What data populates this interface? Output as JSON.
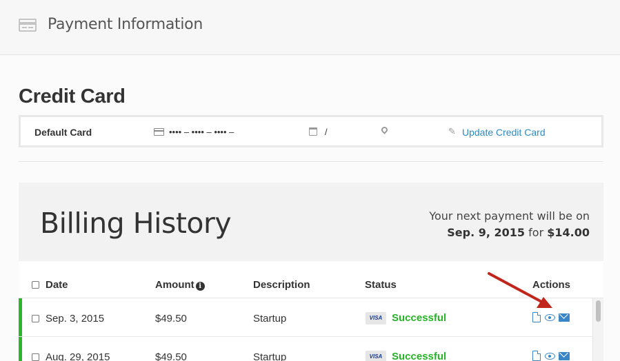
{
  "header": {
    "title": "Payment Information",
    "icon": "credit-card-icon"
  },
  "credit_card": {
    "title": "Credit Card",
    "default_label": "Default Card",
    "number_mask": "•••• – •••• – •••• –",
    "expiry": "/",
    "update_link": "Update Credit Card",
    "link_color": "#2a8ac6"
  },
  "billing": {
    "title": "Billing History",
    "next_payment_prefix": "Your next payment will be on",
    "next_payment_date": "Sep. 9, 2015",
    "next_payment_for": "for",
    "next_payment_amount": "$14.00"
  },
  "table": {
    "columns": [
      "Date",
      "Amount",
      "Description",
      "Status",
      "Actions"
    ],
    "rows": [
      {
        "date": "Sep. 3, 2015",
        "amount": "$49.50",
        "description": "Startup",
        "card": "VISA",
        "status": "Successful"
      },
      {
        "date": "Aug. 29, 2015",
        "amount": "$49.50",
        "description": "Startup",
        "card": "VISA",
        "status": "Successful"
      }
    ]
  },
  "colors": {
    "success": "#27b327",
    "success_bar": "#2db52d",
    "action_icon": "#3b86c6",
    "annotation_arrow": "#c0261b"
  }
}
